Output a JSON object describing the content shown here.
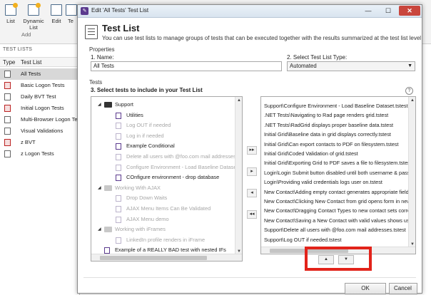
{
  "ribbon": {
    "buttons": [
      "List",
      "Dynamic List",
      "Edit",
      "Te"
    ],
    "group_label": "Add"
  },
  "left_pane": {
    "title": "TEST LISTS",
    "col_type": "Type",
    "col_list": "Test List",
    "items": [
      "All Tests",
      "Basic Logon Tests",
      "Daily BVT Test",
      "Initial Logon Tests",
      "Multi-Browser Logon Tes",
      "Visual Validations",
      "z BVT",
      "z Logon Tests"
    ]
  },
  "dialog": {
    "title": "Edit 'All Tests' Test List",
    "minimize": "—",
    "maximize": "☐",
    "close": "✕",
    "header_title": "Test List",
    "header_desc": "You can use test lists to manage groups of tests that can be executed together with the results summarized at the test list level",
    "properties_label": "Properties",
    "name_label": "1. Name:",
    "name_value": "All Tests",
    "type_label": "2.  Select Test List Type:",
    "type_value": "Automated",
    "tests_label": "Tests",
    "select_label": "3.  Select tests to include in your Test List",
    "help": "?",
    "tree": [
      {
        "text": "Support",
        "kind": "folder",
        "level": 1,
        "muted": false
      },
      {
        "text": "Utilities",
        "kind": "test",
        "level": 2,
        "muted": false
      },
      {
        "text": "Log OUT if needed",
        "kind": "test",
        "level": 2,
        "muted": true
      },
      {
        "text": "Log in if needed",
        "kind": "test",
        "level": 2,
        "muted": true
      },
      {
        "text": "Example Conditional",
        "kind": "test",
        "level": 2,
        "muted": false
      },
      {
        "text": "Delete all users with @foo.com mail addresses",
        "kind": "test",
        "level": 2,
        "muted": true
      },
      {
        "text": "Configure Environment - Load Baseline Dataset",
        "kind": "test",
        "level": 2,
        "muted": true
      },
      {
        "text": "COnfigure environment - drop database",
        "kind": "test",
        "level": 2,
        "muted": false
      },
      {
        "text": "Working With AJAX",
        "kind": "folder",
        "level": 1,
        "muted": true
      },
      {
        "text": "Drop Down Waits",
        "kind": "test",
        "level": 2,
        "muted": true
      },
      {
        "text": "AJAX Menu Items Can Be Validated",
        "kind": "test",
        "level": 2,
        "muted": true
      },
      {
        "text": "AJAX Menu demo",
        "kind": "test",
        "level": 2,
        "muted": true
      },
      {
        "text": "Working with iFrames",
        "kind": "folder",
        "level": 1,
        "muted": true
      },
      {
        "text": "LinkedIn profile renders in iFrame",
        "kind": "test",
        "level": 2,
        "muted": true
      },
      {
        "text": "Example of a REALLY BAD test with nested IFs",
        "kind": "test",
        "level": 1,
        "muted": false
      }
    ],
    "selected": [
      "Support\\Configure Environment - Load Baseline Dataset.tstest",
      ".NET Tests\\Navigating to Rad page renders grid.tstest",
      ".NET Tests\\RadGrid displays proper baseline data.tstest",
      "Initial Grid\\Baseline data in grid displays correctly.tstest",
      "Initial Grid\\Can export contacts to PDF on filesystem.tstest",
      "Initial Grid\\Coded Validation of grid.tstest",
      "Initial Grid\\Exporting Grid to PDF saves a file to filesystem.tstest",
      "Login\\Login Submit button disabled until both username & passw",
      "Login\\Providing valid credentials logs user on.tstest",
      "New Contact\\Adding empty contact generates appropriate field a",
      "New Contact\\Clicking New Contact from grid opens form in new",
      "New Contact\\Dragging Contact Types to new contact sets correct",
      "New Contact\\Saving a New Contact with valid values shows user",
      "Support\\Delete all users with @foo.com mail addresses.tstest",
      "Support\\Log OUT if needed.tstest"
    ],
    "move_buttons": [
      "▸▸",
      "▸",
      "◂",
      "◂◂"
    ],
    "order_up": "▲",
    "order_down": "▼",
    "ok": "OK",
    "cancel": "Cancel",
    "accent_color": "#5b3a8e",
    "highlight_color": "#e2231a"
  }
}
